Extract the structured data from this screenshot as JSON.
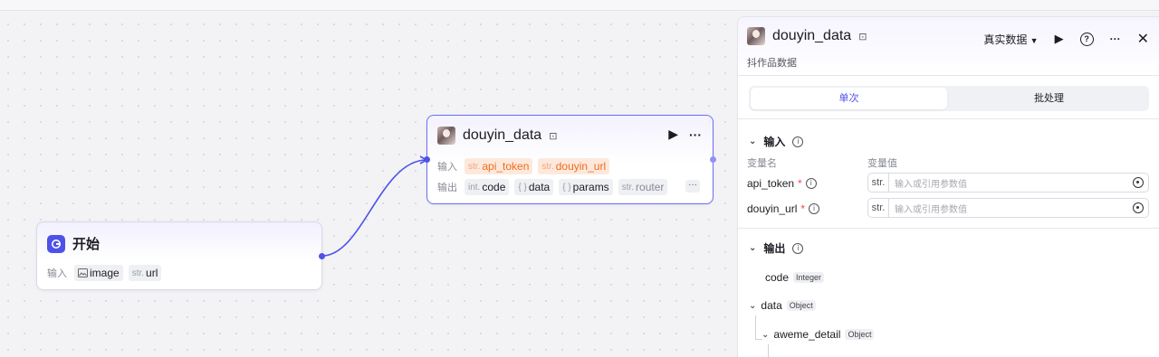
{
  "canvas": {
    "start_node": {
      "title": "开始",
      "input_label": "输入",
      "outputs": [
        {
          "type": "",
          "name": "image",
          "icon": "image-icon"
        },
        {
          "type": "str.",
          "name": "url"
        }
      ]
    },
    "douyin_node": {
      "title": "douyin_data",
      "input_label": "输入",
      "output_label": "输出",
      "inputs": [
        {
          "type": "str.",
          "name": "api_token"
        },
        {
          "type": "str.",
          "name": "douyin_url"
        }
      ],
      "outputs": [
        {
          "type": "int.",
          "name": "code"
        },
        {
          "type": "{ }",
          "name": "data"
        },
        {
          "type": "{ }",
          "name": "params"
        },
        {
          "type": "str.",
          "name": "router"
        }
      ],
      "more": "···"
    }
  },
  "panel": {
    "title": "douyin_data",
    "description": "抖作品数据",
    "mode_select": "真实数据",
    "tabs": [
      "单次",
      "批处理"
    ],
    "input_section": {
      "title": "输入",
      "col_name": "变量名",
      "col_value": "变量值",
      "rows": [
        {
          "name": "api_token",
          "type": "str.",
          "placeholder": "输入或引用参数值"
        },
        {
          "name": "douyin_url",
          "type": "str.",
          "placeholder": "输入或引用参数值"
        }
      ]
    },
    "output_section": {
      "title": "输出",
      "items": [
        {
          "name": "code",
          "type": "Integer"
        },
        {
          "name": "data",
          "type": "Object"
        },
        {
          "name": "aweme_detail",
          "type": "Object"
        }
      ]
    }
  },
  "colors": {
    "accent": "#4d53e8",
    "required": "#f26a1b"
  }
}
